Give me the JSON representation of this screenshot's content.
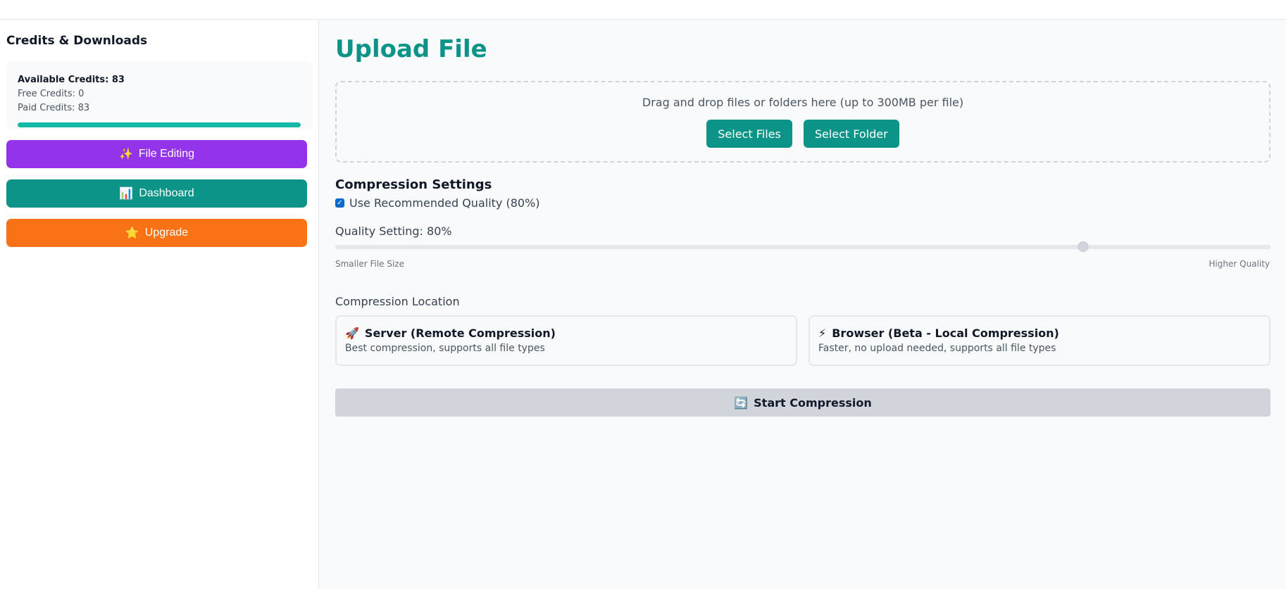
{
  "sidebar": {
    "title": "Credits & Downloads",
    "credits": {
      "available_label": "Available Credits: 83",
      "free_label": "Free Credits: 0",
      "paid_label": "Paid Credits: 83",
      "progress_fraction": 1.0
    },
    "buttons": [
      {
        "icon": "✨",
        "icon_name": "sparkles-icon",
        "label": "File Editing",
        "color": "#9333ea"
      },
      {
        "icon": "📊",
        "icon_name": "bar-chart-icon",
        "label": "Dashboard",
        "color": "#0d9488"
      },
      {
        "icon": "⭐",
        "icon_name": "star-icon",
        "label": "Upgrade",
        "color": "#f97316"
      }
    ]
  },
  "main": {
    "title": "Upload File",
    "dropzone": {
      "text": "Drag and drop files or folders here (up to 300MB per file)",
      "select_files_label": "Select Files",
      "select_folder_label": "Select Folder"
    },
    "compression": {
      "section_title": "Compression Settings",
      "recommended_label": "Use Recommended Quality (80%)",
      "recommended_checked": true,
      "quality_label": "Quality Setting: 80%",
      "quality_value": 80,
      "quality_min": 0,
      "quality_max": 100,
      "slider_min_label": "Smaller File Size",
      "slider_max_label": "Higher Quality"
    },
    "location": {
      "label": "Compression Location",
      "options": [
        {
          "icon": "🚀",
          "icon_name": "rocket-icon",
          "title": "Server (Remote Compression)",
          "desc": "Best compression, supports all file types"
        },
        {
          "icon": "⚡",
          "icon_name": "lightning-icon",
          "title": "Browser (Beta - Local Compression)",
          "desc": "Faster, no upload needed, supports all file types"
        }
      ]
    },
    "start_button": {
      "icon": "🔄",
      "icon_name": "refresh-icon",
      "label": "Start Compression"
    }
  },
  "colors": {
    "accent_teal": "#0d9488",
    "progress": "#14b8a6",
    "purple": "#9333ea",
    "orange": "#f97316"
  }
}
